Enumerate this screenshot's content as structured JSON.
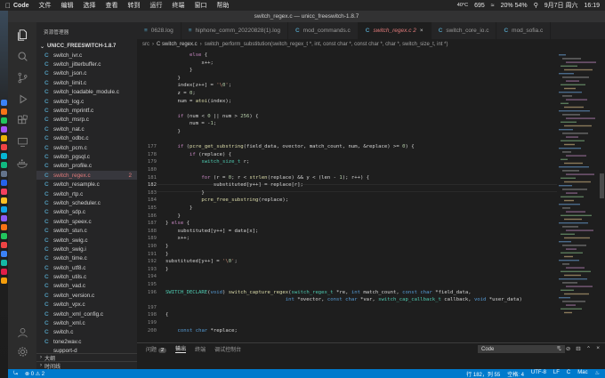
{
  "menubar": {
    "app": "Code",
    "items": [
      "文件",
      "编辑",
      "选择",
      "查看",
      "转到",
      "运行",
      "终端",
      "窗口",
      "帮助"
    ],
    "temp": "40°C",
    "temp2": "47°C",
    "battery": "695",
    "mem": "20% 54%",
    "date": "9月7日 周六",
    "time": "16:19"
  },
  "window": {
    "title": "switch_regex.c — unicc_freeswitch-1.8.7"
  },
  "sidebar": {
    "header": "资源管理器",
    "section": "UNICC_FREESWITCH-1.8.7",
    "files": [
      {
        "icon": "C",
        "name": "switch_ivr.c"
      },
      {
        "icon": "C",
        "name": "switch_jitterbuffer.c"
      },
      {
        "icon": "C",
        "name": "switch_json.c"
      },
      {
        "icon": "C",
        "name": "switch_limit.c"
      },
      {
        "icon": "C",
        "name": "switch_loadable_module.c"
      },
      {
        "icon": "C",
        "name": "switch_log.c"
      },
      {
        "icon": "C",
        "name": "switch_mprintf.c"
      },
      {
        "icon": "C",
        "name": "switch_msrp.c"
      },
      {
        "icon": "C",
        "name": "switch_nat.c"
      },
      {
        "icon": "C",
        "name": "switch_odbc.c"
      },
      {
        "icon": "C",
        "name": "switch_pcm.c"
      },
      {
        "icon": "C",
        "name": "switch_pgsql.c"
      },
      {
        "icon": "C",
        "name": "switch_profile.c"
      },
      {
        "icon": "C",
        "name": "switch_regex.c",
        "selected": true,
        "badge": "2"
      },
      {
        "icon": "C",
        "name": "switch_resample.c"
      },
      {
        "icon": "C",
        "name": "switch_rtp.c"
      },
      {
        "icon": "C",
        "name": "switch_scheduler.c"
      },
      {
        "icon": "C",
        "name": "switch_sdp.c"
      },
      {
        "icon": "C",
        "name": "switch_speex.c"
      },
      {
        "icon": "C",
        "name": "switch_stun.c"
      },
      {
        "icon": "C",
        "name": "switch_swig.c"
      },
      {
        "icon": "C",
        "name": "switch_swig.i"
      },
      {
        "icon": "C",
        "name": "switch_time.c"
      },
      {
        "icon": "C",
        "name": "switch_utf8.c"
      },
      {
        "icon": "C",
        "name": "switch_utils.c"
      },
      {
        "icon": "C",
        "name": "switch_vad.c"
      },
      {
        "icon": "C",
        "name": "switch_version.c"
      },
      {
        "icon": "C",
        "name": "switch_vpx.c"
      },
      {
        "icon": "C",
        "name": "switch_xml_config.c"
      },
      {
        "icon": "C",
        "name": "switch_xml.c"
      },
      {
        "icon": "C",
        "name": "switch.c"
      },
      {
        "icon": "C",
        "name": "tone2wav.c"
      },
      {
        "icon": "",
        "name": "support-d"
      }
    ],
    "outline": "大纲",
    "timeline": "时间线"
  },
  "tabs": [
    {
      "name": "0628.log",
      "icon": "≡",
      "active": false
    },
    {
      "name": "hiphone_comm_20220828(1).log",
      "icon": "≡",
      "active": false
    },
    {
      "name": "mod_commands.c",
      "icon": "C",
      "active": false
    },
    {
      "name": "switch_regex.c 2",
      "icon": "C",
      "active": true
    },
    {
      "name": "switch_core_io.c",
      "icon": "C",
      "active": false
    },
    {
      "name": "mod_sofia.c",
      "icon": "C",
      "active": false
    }
  ],
  "breadcrumb": [
    "src",
    "C switch_regex.c",
    "switch_perform_substitution(switch_regex_t *, int, const char *, const char *, char *, switch_size_t, int *)"
  ],
  "editor": {
    "lines": [
      {
        "n": "",
        "t": "        else {"
      },
      {
        "n": "",
        "t": "            x++;"
      },
      {
        "n": "",
        "t": "        }"
      },
      {
        "n": "",
        "t": "    }"
      },
      {
        "n": "",
        "t": "    index[z++] = '\\0';"
      },
      {
        "n": "",
        "t": "    z = 0;"
      },
      {
        "n": "",
        "t": "    num = atoi(index);"
      },
      {
        "n": "",
        "t": ""
      },
      {
        "n": "",
        "t": "    if (num < 0 || num > 256) {"
      },
      {
        "n": "",
        "t": "        num = -1;"
      },
      {
        "n": "",
        "t": "    }"
      },
      {
        "n": "",
        "t": ""
      },
      {
        "n": "177",
        "t": "    if (pcre_get_substring(field_data, ovector, match_count, num, &replace) >= 0) {"
      },
      {
        "n": "178",
        "t": "        if (replace) {"
      },
      {
        "n": "179",
        "t": "            switch_size_t r;"
      },
      {
        "n": "180",
        "t": ""
      },
      {
        "n": "181",
        "t": "            for (r = 0; r < strlen(replace) && y < (len - 1); r++) {"
      },
      {
        "n": "182",
        "t": "                substituted[y++] = replace[r];"
      },
      {
        "n": "183",
        "t": "            }"
      },
      {
        "n": "184",
        "t": "            pcre_free_substring(replace);"
      },
      {
        "n": "185",
        "t": "        }"
      },
      {
        "n": "186",
        "t": "    }"
      },
      {
        "n": "187",
        "t": "} else {"
      },
      {
        "n": "188",
        "t": "    substituted[y++] = data[x];"
      },
      {
        "n": "189",
        "t": "    x++;"
      },
      {
        "n": "190",
        "t": "}"
      },
      {
        "n": "191",
        "t": "}"
      },
      {
        "n": "192",
        "t": "substituted[y++] = '\\0';"
      },
      {
        "n": "193",
        "t": "}"
      },
      {
        "n": "194",
        "t": ""
      },
      {
        "n": "195",
        "t": ""
      },
      {
        "n": "196",
        "t": "SWITCH_DECLARE(void) switch_capture_regex(switch_regex_t *re, int match_count, const char *field_data,"
      },
      {
        "n": "",
        "t": "                                        int *ovector, const char *var, switch_cap_callback_t callback, void *user_data)"
      },
      {
        "n": "197",
        "t": ""
      },
      {
        "n": "198",
        "t": "{"
      },
      {
        "n": "199",
        "t": ""
      },
      {
        "n": "200",
        "t": "    const char *replace;"
      }
    ]
  },
  "panel": {
    "tabs": [
      "问题",
      "输出",
      "终端",
      "调试控制台"
    ],
    "problems_count": "2",
    "active": "输出",
    "select": "Code"
  },
  "status": {
    "left": [
      "⊗ 0 ⚠ 2"
    ],
    "position": "行 182，列 55",
    "indent": "空格: 4",
    "encoding": "UTF-8",
    "eol": "LF",
    "lang": "C",
    "os": "Mac"
  }
}
